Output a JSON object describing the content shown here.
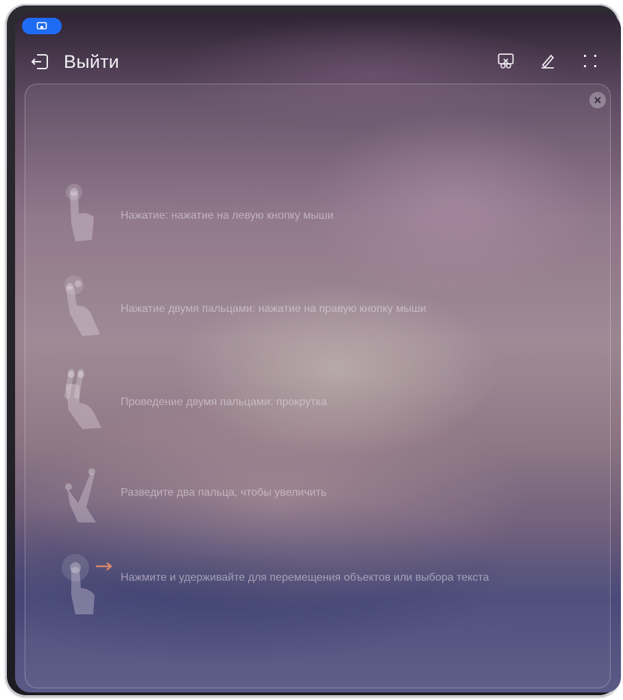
{
  "topbar": {
    "exit_label": "Выйти",
    "icons": [
      "exit-icon",
      "pointer-mode-icon",
      "pen-icon",
      "fullscreen-icon"
    ]
  },
  "mode_indicator": {
    "icon": "screen-cast-icon",
    "color": "#1f6cf4"
  },
  "tutorial": {
    "items": [
      {
        "icon": "tap-gesture-icon",
        "text": "Нажатие: нажатие на левую кнопку мыши"
      },
      {
        "icon": "two-finger-tap-icon",
        "text": "Нажатие двумя пальцами: нажатие на правую кнопку мыши"
      },
      {
        "icon": "two-finger-swipe-icon",
        "text": "Проведение двумя пальцами: прокрутка"
      },
      {
        "icon": "pinch-zoom-icon",
        "text": "Разведите два пальца, чтобы увеличить"
      },
      {
        "icon": "press-hold-drag-icon",
        "text": "Нажмите и удерживайте для перемещения объектов или выбора текста"
      }
    ],
    "close_icon": "close-icon"
  }
}
